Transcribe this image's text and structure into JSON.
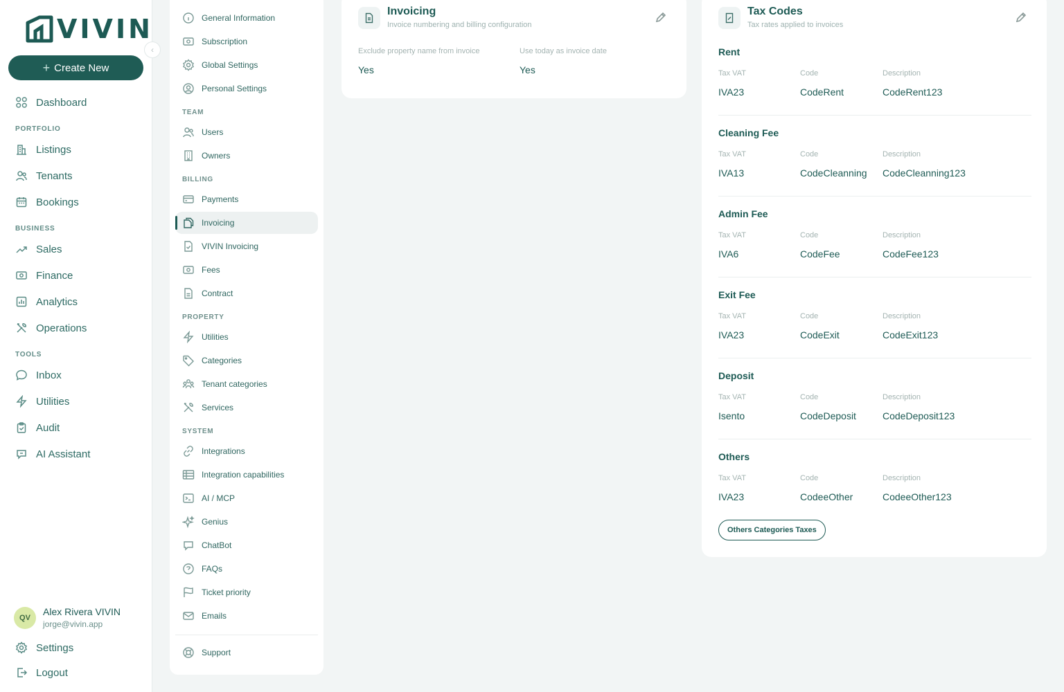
{
  "app": {
    "logo_text": "VIVIN",
    "create_label": "Create New"
  },
  "nav": {
    "dashboard": "Dashboard",
    "sections": {
      "portfolio": "PORTFOLIO",
      "business": "BUSINESS",
      "tools": "TOOLS"
    },
    "portfolio": [
      "Listings",
      "Tenants",
      "Bookings"
    ],
    "business": [
      "Sales",
      "Finance",
      "Analytics",
      "Operations"
    ],
    "tools": [
      "Inbox",
      "Utilities",
      "Audit",
      "AI Assistant"
    ],
    "settings": "Settings",
    "logout": "Logout"
  },
  "user": {
    "initials": "QV",
    "name": "Alex Rivera VIVIN",
    "email": "jorge@vivin.app"
  },
  "settings_menu": {
    "general": [
      "General Information",
      "Subscription",
      "Global Settings",
      "Personal Settings"
    ],
    "team_label": "TEAM",
    "team": [
      "Users",
      "Owners"
    ],
    "billing_label": "BILLING",
    "billing": [
      "Payments",
      "Invoicing",
      "VIVIN Invoicing",
      "Fees",
      "Contract"
    ],
    "property_label": "PROPERTY",
    "property": [
      "Utilities",
      "Categories",
      "Tenant categories",
      "Services"
    ],
    "system_label": "SYSTEM",
    "system": [
      "Integrations",
      "Integration capabilities",
      "AI / MCP",
      "Genius",
      "ChatBot",
      "FAQs",
      "Ticket priority",
      "Emails"
    ],
    "support": "Support",
    "active": "Invoicing"
  },
  "invoicing": {
    "title": "Invoicing",
    "subtitle": "Invoice numbering and billing configuration",
    "fields": [
      {
        "label": "Exclude property name from invoice",
        "value": "Yes"
      },
      {
        "label": "Use today as invoice date",
        "value": "Yes"
      }
    ]
  },
  "tax_codes": {
    "title": "Tax Codes",
    "subtitle": "Tax rates applied to invoices",
    "col_labels": {
      "vat": "Tax VAT",
      "code": "Code",
      "description": "Description"
    },
    "groups": [
      {
        "name": "Rent",
        "vat": "IVA23",
        "code": "CodeRent",
        "description": "CodeRent123"
      },
      {
        "name": "Cleaning Fee",
        "vat": "IVA13",
        "code": "CodeCleanning",
        "description": "CodeCleanning123"
      },
      {
        "name": "Admin Fee",
        "vat": "IVA6",
        "code": "CodeFee",
        "description": "CodeFee123"
      },
      {
        "name": "Exit Fee",
        "vat": "IVA23",
        "code": "CodeExit",
        "description": "CodeExit123"
      },
      {
        "name": "Deposit",
        "vat": "Isento",
        "code": "CodeDeposit",
        "description": "CodeDeposit123"
      },
      {
        "name": "Others",
        "vat": "IVA23",
        "code": "CodeeOther",
        "description": "CodeeOther123"
      }
    ],
    "others_button": "Others Categories Taxes"
  }
}
